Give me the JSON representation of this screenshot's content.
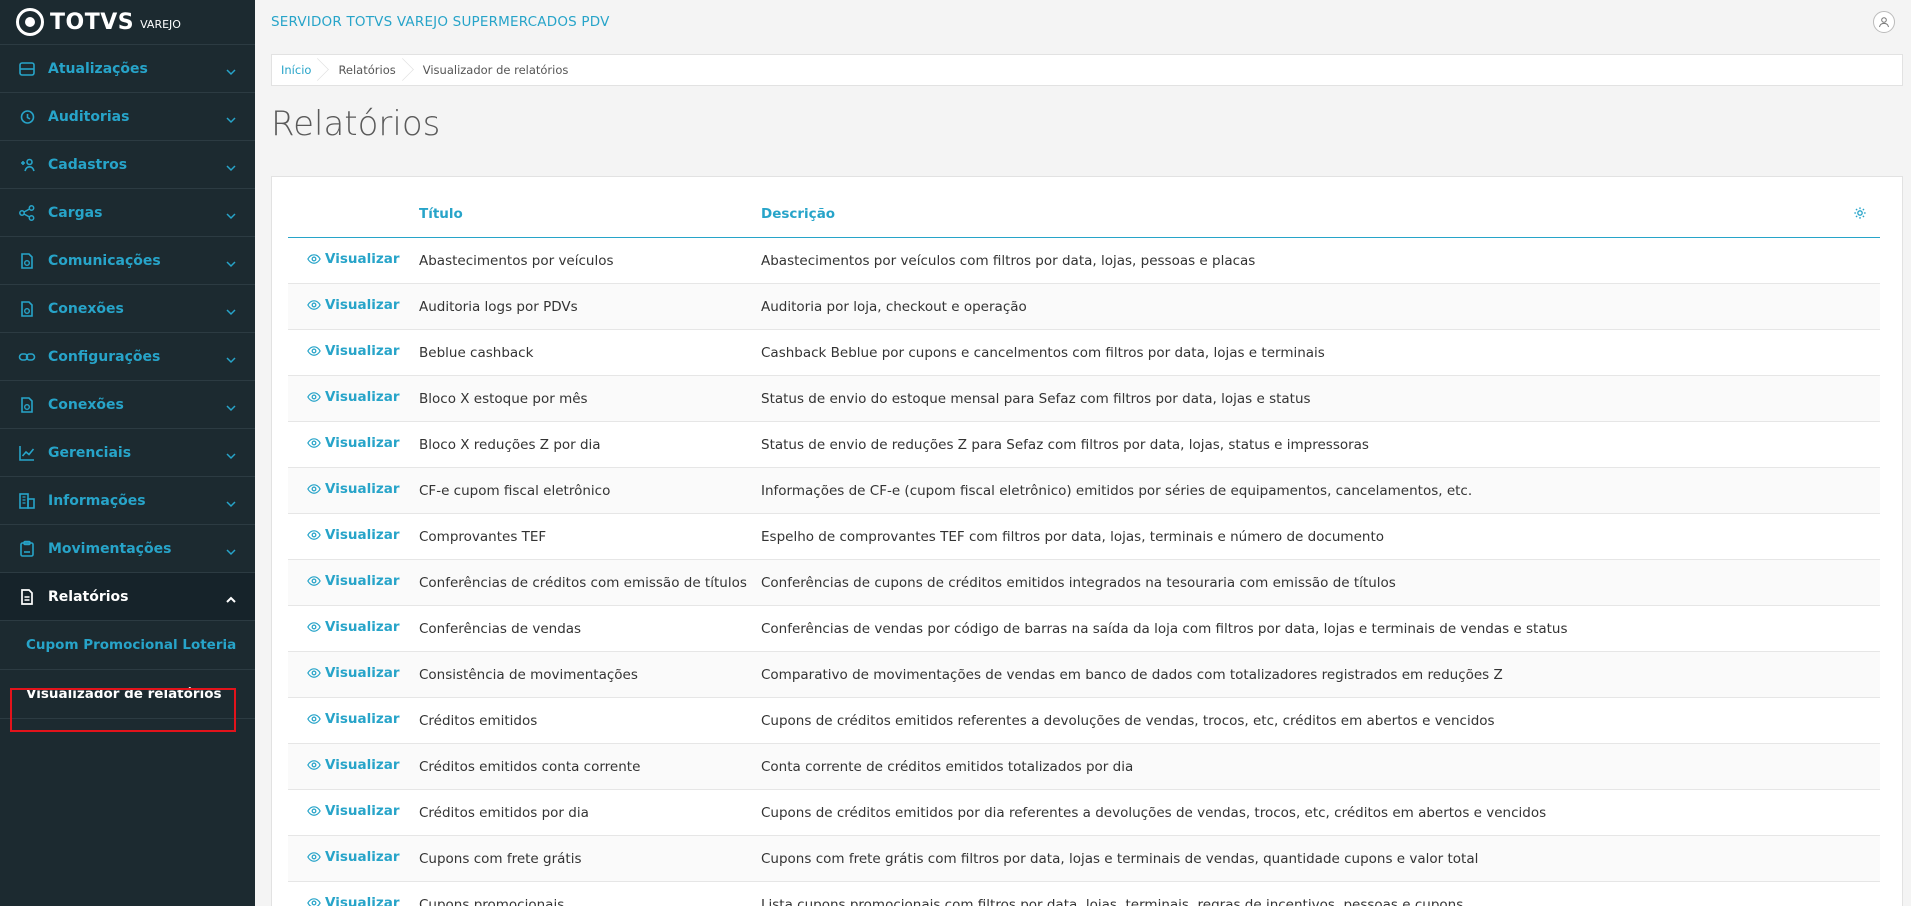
{
  "brand": {
    "name": "TOTVS",
    "sub": "VAREJO"
  },
  "sidebar": {
    "items": [
      {
        "label": "Atualizações",
        "icon": "database-icon"
      },
      {
        "label": "Auditorias",
        "icon": "history-icon"
      },
      {
        "label": "Cadastros",
        "icon": "add-user-icon"
      },
      {
        "label": "Cargas",
        "icon": "share-icon"
      },
      {
        "label": "Comunicações",
        "icon": "document-sync-icon"
      },
      {
        "label": "Conexões",
        "icon": "document-sync-icon"
      },
      {
        "label": "Configurações",
        "icon": "link-icon"
      },
      {
        "label": "Conexões",
        "icon": "document-sync-icon"
      },
      {
        "label": "Gerenciais",
        "icon": "chart-icon"
      },
      {
        "label": "Informações",
        "icon": "building-icon"
      },
      {
        "label": "Movimentações",
        "icon": "clipboard-icon"
      },
      {
        "label": "Relatórios",
        "icon": "report-icon"
      }
    ],
    "subitems": [
      {
        "label": "Cupom Promocional Loteria"
      },
      {
        "label": "Visualizador de relatórios"
      }
    ]
  },
  "header": {
    "title": "SERVIDOR TOTVS VAREJO SUPERMERCADOS PDV"
  },
  "breadcrumb": [
    "Início",
    "Relatórios",
    "Visualizador de relatórios"
  ],
  "page": {
    "title": "Relatórios"
  },
  "table": {
    "headers": {
      "title": "Título",
      "description": "Descrição"
    },
    "action_label": "Visualizar",
    "rows": [
      {
        "title": "Abastecimentos por veículos",
        "description": "Abastecimentos por veículos com filtros por data, lojas, pessoas e placas"
      },
      {
        "title": "Auditoria logs por PDVs",
        "description": "Auditoria por loja, checkout e operação"
      },
      {
        "title": "Beblue cashback",
        "description": "Cashback Beblue por cupons e cancelmentos com filtros por data, lojas e terminais"
      },
      {
        "title": "Bloco X estoque por mês",
        "description": "Status de envio do estoque mensal para Sefaz com filtros por data, lojas e status"
      },
      {
        "title": "Bloco X reduções Z por dia",
        "description": "Status de envio de reduções Z para Sefaz com filtros por data, lojas, status e impressoras"
      },
      {
        "title": "CF-e cupom fiscal eletrônico",
        "description": "Informações de CF-e (cupom fiscal eletrônico) emitidos por séries de equipamentos, cancelamentos, etc."
      },
      {
        "title": "Comprovantes TEF",
        "description": "Espelho de comprovantes TEF com filtros por data, lojas, terminais e número de documento"
      },
      {
        "title": "Conferências de créditos com emissão de títulos",
        "description": "Conferências de cupons de créditos emitidos integrados na tesouraria com emissão de títulos"
      },
      {
        "title": "Conferências de vendas",
        "description": "Conferências de vendas por código de barras na saída da loja com filtros por data, lojas e terminais de vendas e status"
      },
      {
        "title": "Consistência de movimentações",
        "description": "Comparativo de movimentações de vendas em banco de dados com totalizadores registrados em reduções Z"
      },
      {
        "title": "Créditos emitidos",
        "description": "Cupons de créditos emitidos referentes a devoluções de vendas, trocos, etc, créditos em abertos e vencidos"
      },
      {
        "title": "Créditos emitidos conta corrente",
        "description": "Conta corrente de créditos emitidos totalizados por dia"
      },
      {
        "title": "Créditos emitidos por dia",
        "description": "Cupons de créditos emitidos por dia referentes a devoluções de vendas, trocos, etc, créditos em abertos e vencidos"
      },
      {
        "title": "Cupons com frete grátis",
        "description": "Cupons com frete grátis com filtros por data, lojas e terminais de vendas, quantidade cupons e valor total"
      },
      {
        "title": "Cupons promocionais",
        "description": "Lista cupons promocionais com filtros por data, lojas, terminais, regras de incentivos, pessoas e cupons"
      }
    ]
  },
  "colors": {
    "accent": "#27a4c9",
    "sidebar_bg": "#1c2a30",
    "highlight": "#e2131b"
  }
}
